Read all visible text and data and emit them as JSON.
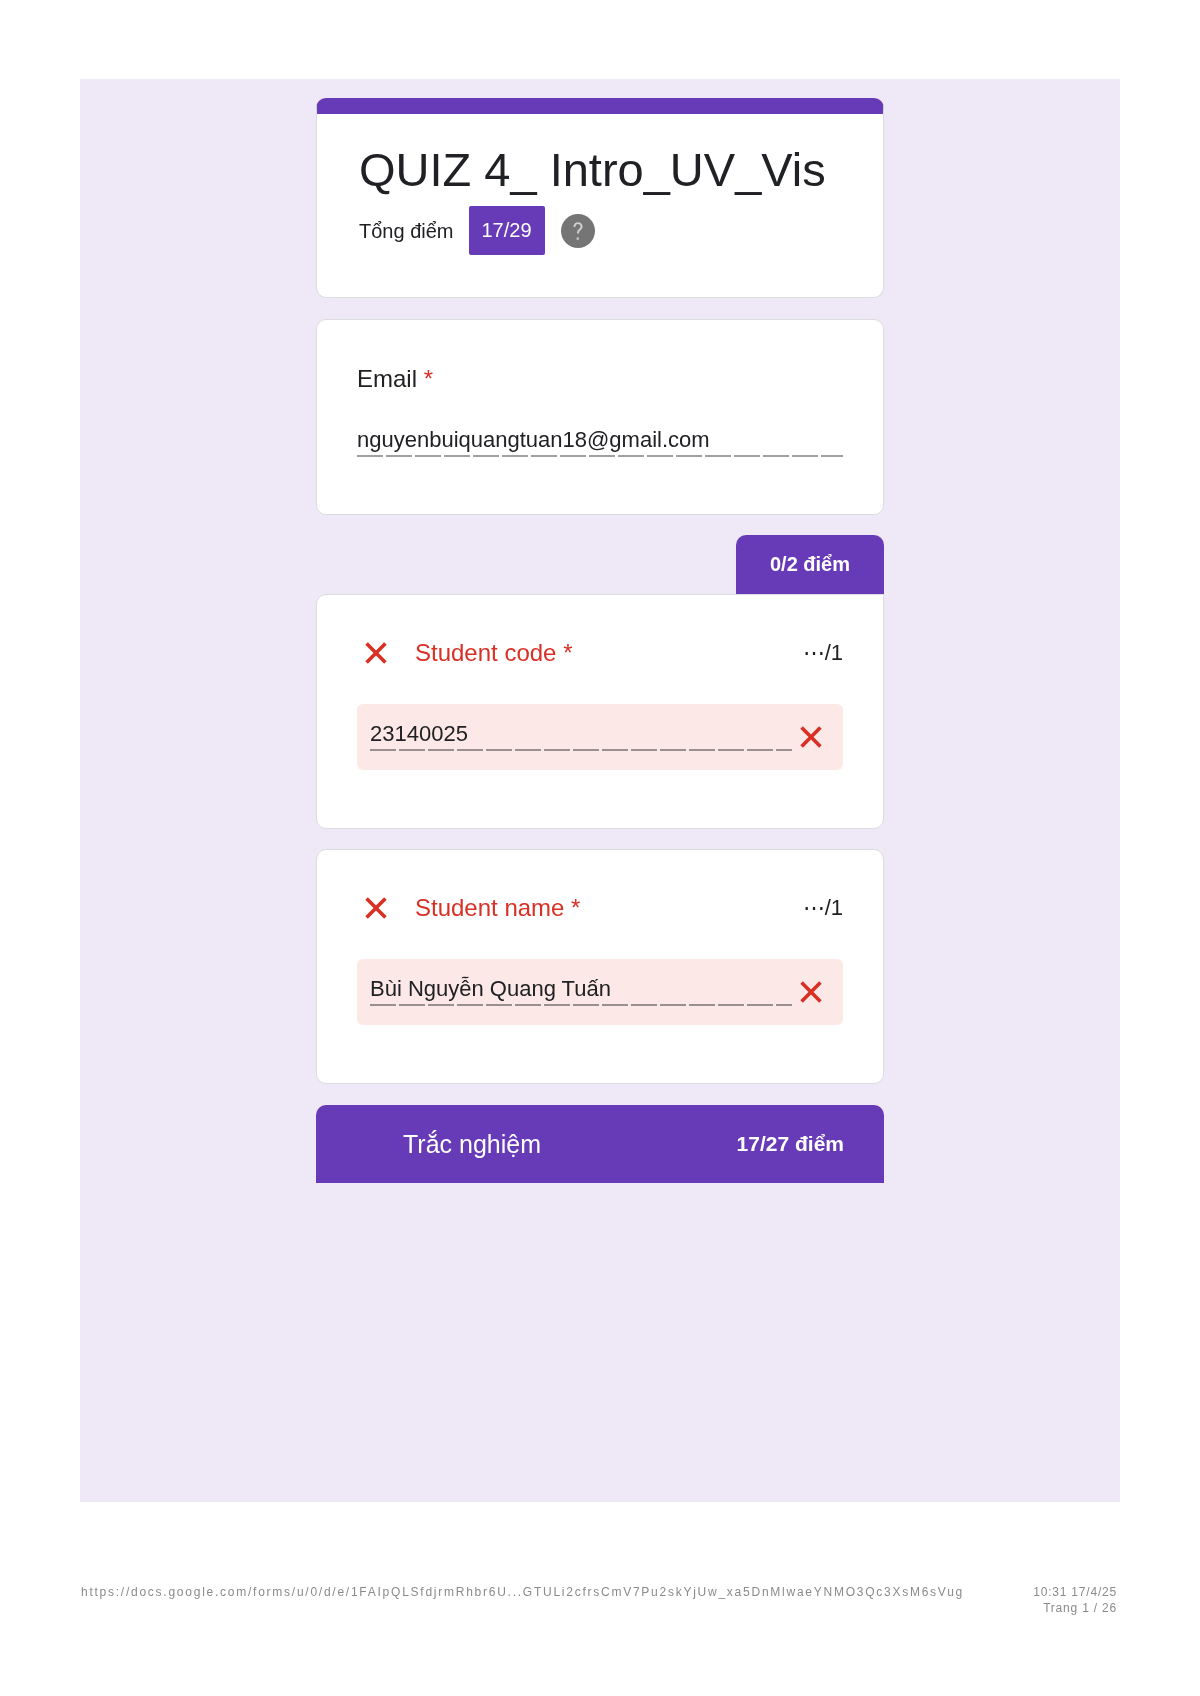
{
  "form": {
    "title": "QUIZ 4_ Intro_UV_Vis",
    "total_label": "Tổng điểm",
    "total_score": "17/29"
  },
  "email_question": {
    "label": "Email",
    "required_mark": "*",
    "answer": "nguyenbuiquangtuan18@gmail.com"
  },
  "graded_section": {
    "score": "0/2 điểm",
    "questions": [
      {
        "label": "Student code",
        "required_mark": "*",
        "points": "⋯/1",
        "correct": false,
        "answer": "23140025"
      },
      {
        "label": "Student name",
        "required_mark": "*",
        "points": "⋯/1",
        "correct": false,
        "answer": "Bùi Nguyễn Quang Tuấn"
      }
    ]
  },
  "next_section": {
    "title": "Trắc nghiệm",
    "score": "17/27 điểm"
  },
  "footer": {
    "url": "https://docs.google.com/forms/u/0/d/e/1FAIpQLSfdjrmRhbr6U...GTULi2cfrsCmV7Pu2skYjUw_xa5DnMlwaeYNMO3Qc3XsM6sVug",
    "timestamp": "10:31 17/4/25",
    "page": "Trang 1 / 26"
  }
}
